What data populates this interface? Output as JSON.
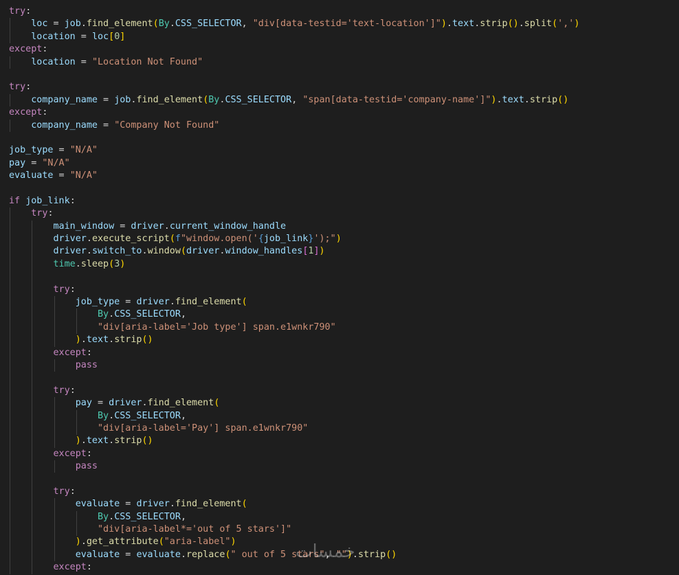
{
  "editor": {
    "background": "#1e1e1e",
    "colors": {
      "keyword": "#c586c0",
      "variable": "#9cdcfe",
      "function": "#dcdcaa",
      "class": "#4ec9b0",
      "string": "#ce9178",
      "number": "#b5cea8",
      "operator": "#d4d4d4",
      "bracket_level_1": "#ffd700",
      "bracket_level_2": "#da70d6",
      "bracket_level_3": "#179fff"
    },
    "lines": [
      {
        "indent": 0,
        "tokens": [
          [
            "kw",
            "try"
          ],
          [
            "op",
            ":"
          ]
        ]
      },
      {
        "indent": 1,
        "tokens": [
          [
            "var",
            "loc"
          ],
          [
            "op",
            " = "
          ],
          [
            "var",
            "job"
          ],
          [
            "op",
            "."
          ],
          [
            "fn",
            "find_element"
          ],
          [
            "br1",
            "("
          ],
          [
            "cls",
            "By"
          ],
          [
            "op",
            "."
          ],
          [
            "var",
            "CSS_SELECTOR"
          ],
          [
            "op",
            ", "
          ],
          [
            "str",
            "\"div[data-testid='text-location']\""
          ],
          [
            "br1",
            ")"
          ],
          [
            "op",
            "."
          ],
          [
            "var",
            "text"
          ],
          [
            "op",
            "."
          ],
          [
            "fn",
            "strip"
          ],
          [
            "br1",
            "()"
          ],
          [
            "op",
            "."
          ],
          [
            "fn",
            "split"
          ],
          [
            "br1",
            "("
          ],
          [
            "str",
            "','"
          ],
          [
            "br1",
            ")"
          ]
        ]
      },
      {
        "indent": 1,
        "tokens": [
          [
            "var",
            "location"
          ],
          [
            "op",
            " = "
          ],
          [
            "var",
            "loc"
          ],
          [
            "br1",
            "["
          ],
          [
            "num",
            "0"
          ],
          [
            "br1",
            "]"
          ]
        ]
      },
      {
        "indent": 0,
        "tokens": [
          [
            "kw",
            "except"
          ],
          [
            "op",
            ":"
          ]
        ]
      },
      {
        "indent": 1,
        "tokens": [
          [
            "var",
            "location"
          ],
          [
            "op",
            " = "
          ],
          [
            "str",
            "\"Location Not Found\""
          ]
        ]
      },
      {
        "indent": 0,
        "tokens": []
      },
      {
        "indent": 0,
        "tokens": [
          [
            "kw",
            "try"
          ],
          [
            "op",
            ":"
          ]
        ]
      },
      {
        "indent": 1,
        "tokens": [
          [
            "var",
            "company_name"
          ],
          [
            "op",
            " = "
          ],
          [
            "var",
            "job"
          ],
          [
            "op",
            "."
          ],
          [
            "fn",
            "find_element"
          ],
          [
            "br1",
            "("
          ],
          [
            "cls",
            "By"
          ],
          [
            "op",
            "."
          ],
          [
            "var",
            "CSS_SELECTOR"
          ],
          [
            "op",
            ", "
          ],
          [
            "str",
            "\"span[data-testid='company-name']\""
          ],
          [
            "br1",
            ")"
          ],
          [
            "op",
            "."
          ],
          [
            "var",
            "text"
          ],
          [
            "op",
            "."
          ],
          [
            "fn",
            "strip"
          ],
          [
            "br1",
            "()"
          ]
        ]
      },
      {
        "indent": 0,
        "tokens": [
          [
            "kw",
            "except"
          ],
          [
            "op",
            ":"
          ]
        ]
      },
      {
        "indent": 1,
        "tokens": [
          [
            "var",
            "company_name"
          ],
          [
            "op",
            " = "
          ],
          [
            "str",
            "\"Company Not Found\""
          ]
        ]
      },
      {
        "indent": 0,
        "tokens": []
      },
      {
        "indent": 0,
        "tokens": [
          [
            "var",
            "job_type"
          ],
          [
            "op",
            " = "
          ],
          [
            "str",
            "\"N/A\""
          ]
        ]
      },
      {
        "indent": 0,
        "tokens": [
          [
            "var",
            "pay"
          ],
          [
            "op",
            " = "
          ],
          [
            "str",
            "\"N/A\""
          ]
        ]
      },
      {
        "indent": 0,
        "tokens": [
          [
            "var",
            "evaluate"
          ],
          [
            "op",
            " = "
          ],
          [
            "str",
            "\"N/A\""
          ]
        ]
      },
      {
        "indent": 0,
        "tokens": []
      },
      {
        "indent": 0,
        "tokens": [
          [
            "kw",
            "if"
          ],
          [
            "op",
            " "
          ],
          [
            "var",
            "job_link"
          ],
          [
            "op",
            ":"
          ]
        ]
      },
      {
        "indent": 1,
        "tokens": [
          [
            "kw",
            "try"
          ],
          [
            "op",
            ":"
          ]
        ]
      },
      {
        "indent": 2,
        "tokens": [
          [
            "var",
            "main_window"
          ],
          [
            "op",
            " = "
          ],
          [
            "var",
            "driver"
          ],
          [
            "op",
            "."
          ],
          [
            "var",
            "current_window_handle"
          ]
        ]
      },
      {
        "indent": 2,
        "tokens": [
          [
            "var",
            "driver"
          ],
          [
            "op",
            "."
          ],
          [
            "fn",
            "execute_script"
          ],
          [
            "br1",
            "("
          ],
          [
            "kwb",
            "f"
          ],
          [
            "str",
            "\"window.open('"
          ],
          [
            "kwb",
            "{"
          ],
          [
            "var",
            "job_link"
          ],
          [
            "kwb",
            "}"
          ],
          [
            "str",
            "');\""
          ],
          [
            "br1",
            ")"
          ]
        ]
      },
      {
        "indent": 2,
        "tokens": [
          [
            "var",
            "driver"
          ],
          [
            "op",
            "."
          ],
          [
            "var",
            "switch_to"
          ],
          [
            "op",
            "."
          ],
          [
            "fn",
            "window"
          ],
          [
            "br1",
            "("
          ],
          [
            "var",
            "driver"
          ],
          [
            "op",
            "."
          ],
          [
            "var",
            "window_handles"
          ],
          [
            "br2",
            "["
          ],
          [
            "num",
            "1"
          ],
          [
            "br2",
            "]"
          ],
          [
            "br1",
            ")"
          ]
        ]
      },
      {
        "indent": 2,
        "tokens": [
          [
            "cls",
            "time"
          ],
          [
            "op",
            "."
          ],
          [
            "fn",
            "sleep"
          ],
          [
            "br1",
            "("
          ],
          [
            "num",
            "3"
          ],
          [
            "br1",
            ")"
          ]
        ]
      },
      {
        "indent": 2,
        "tokens": []
      },
      {
        "indent": 2,
        "tokens": [
          [
            "kw",
            "try"
          ],
          [
            "op",
            ":"
          ]
        ]
      },
      {
        "indent": 3,
        "tokens": [
          [
            "var",
            "job_type"
          ],
          [
            "op",
            " = "
          ],
          [
            "var",
            "driver"
          ],
          [
            "op",
            "."
          ],
          [
            "fn",
            "find_element"
          ],
          [
            "br1",
            "("
          ]
        ]
      },
      {
        "indent": 4,
        "tokens": [
          [
            "cls",
            "By"
          ],
          [
            "op",
            "."
          ],
          [
            "var",
            "CSS_SELECTOR"
          ],
          [
            "op",
            ","
          ]
        ]
      },
      {
        "indent": 4,
        "tokens": [
          [
            "str",
            "\"div[aria-label='Job type'] span.e1wnkr790\""
          ]
        ]
      },
      {
        "indent": 3,
        "tokens": [
          [
            "br1",
            ")"
          ],
          [
            "op",
            "."
          ],
          [
            "var",
            "text"
          ],
          [
            "op",
            "."
          ],
          [
            "fn",
            "strip"
          ],
          [
            "br1",
            "()"
          ]
        ]
      },
      {
        "indent": 2,
        "tokens": [
          [
            "kw",
            "except"
          ],
          [
            "op",
            ":"
          ]
        ]
      },
      {
        "indent": 3,
        "tokens": [
          [
            "kw",
            "pass"
          ]
        ]
      },
      {
        "indent": 2,
        "tokens": []
      },
      {
        "indent": 2,
        "tokens": [
          [
            "kw",
            "try"
          ],
          [
            "op",
            ":"
          ]
        ]
      },
      {
        "indent": 3,
        "tokens": [
          [
            "var",
            "pay"
          ],
          [
            "op",
            " = "
          ],
          [
            "var",
            "driver"
          ],
          [
            "op",
            "."
          ],
          [
            "fn",
            "find_element"
          ],
          [
            "br1",
            "("
          ]
        ]
      },
      {
        "indent": 4,
        "tokens": [
          [
            "cls",
            "By"
          ],
          [
            "op",
            "."
          ],
          [
            "var",
            "CSS_SELECTOR"
          ],
          [
            "op",
            ","
          ]
        ]
      },
      {
        "indent": 4,
        "tokens": [
          [
            "str",
            "\"div[aria-label='Pay'] span.e1wnkr790\""
          ]
        ]
      },
      {
        "indent": 3,
        "tokens": [
          [
            "br1",
            ")"
          ],
          [
            "op",
            "."
          ],
          [
            "var",
            "text"
          ],
          [
            "op",
            "."
          ],
          [
            "fn",
            "strip"
          ],
          [
            "br1",
            "()"
          ]
        ]
      },
      {
        "indent": 2,
        "tokens": [
          [
            "kw",
            "except"
          ],
          [
            "op",
            ":"
          ]
        ]
      },
      {
        "indent": 3,
        "tokens": [
          [
            "kw",
            "pass"
          ]
        ]
      },
      {
        "indent": 2,
        "tokens": []
      },
      {
        "indent": 2,
        "tokens": [
          [
            "kw",
            "try"
          ],
          [
            "op",
            ":"
          ]
        ]
      },
      {
        "indent": 3,
        "tokens": [
          [
            "var",
            "evaluate"
          ],
          [
            "op",
            " = "
          ],
          [
            "var",
            "driver"
          ],
          [
            "op",
            "."
          ],
          [
            "fn",
            "find_element"
          ],
          [
            "br1",
            "("
          ]
        ]
      },
      {
        "indent": 4,
        "tokens": [
          [
            "cls",
            "By"
          ],
          [
            "op",
            "."
          ],
          [
            "var",
            "CSS_SELECTOR"
          ],
          [
            "op",
            ","
          ]
        ]
      },
      {
        "indent": 4,
        "tokens": [
          [
            "str",
            "\"div[aria-label*='out of 5 stars']\""
          ]
        ]
      },
      {
        "indent": 3,
        "tokens": [
          [
            "br1",
            ")"
          ],
          [
            "op",
            "."
          ],
          [
            "fn",
            "get_attribute"
          ],
          [
            "br1",
            "("
          ],
          [
            "str",
            "\"aria-label\""
          ],
          [
            "br1",
            ")"
          ]
        ]
      },
      {
        "indent": 3,
        "tokens": [
          [
            "var",
            "evaluate"
          ],
          [
            "op",
            " = "
          ],
          [
            "var",
            "evaluate"
          ],
          [
            "op",
            "."
          ],
          [
            "fn",
            "replace"
          ],
          [
            "br1",
            "("
          ],
          [
            "str",
            "\" out of 5 stars\""
          ],
          [
            "op",
            ", "
          ],
          [
            "str",
            "\"\""
          ],
          [
            "br1",
            ")"
          ],
          [
            "op",
            "."
          ],
          [
            "fn",
            "strip"
          ],
          [
            "br1",
            "()"
          ]
        ]
      },
      {
        "indent": 2,
        "tokens": [
          [
            "kw",
            "except"
          ],
          [
            "op",
            ":"
          ]
        ]
      }
    ]
  },
  "watermark": {
    "text": "خمسات"
  }
}
